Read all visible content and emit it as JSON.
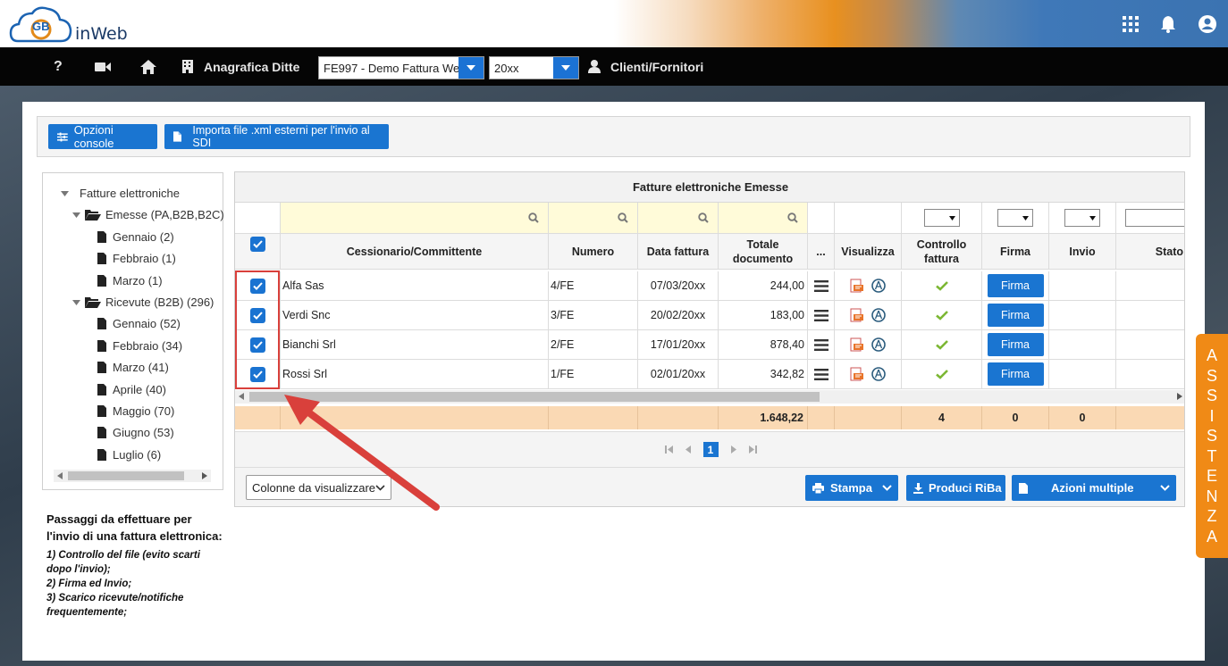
{
  "header": {
    "logo_text": "inWeb",
    "logo_badge": "GB",
    "icons": [
      "apps-grid-icon",
      "bell-icon",
      "user-circle-icon"
    ]
  },
  "navbar": {
    "help": "?",
    "company_label": "Anagrafica Ditte",
    "company_select": "FE997 - Demo Fattura We",
    "year_select": "20xx",
    "clients_label": "Clienti/Fornitori"
  },
  "toolbar": {
    "options_label": "Opzioni console",
    "import_label": "Importa file .xml esterni per l'invio al SDI"
  },
  "tree": {
    "root": "Fatture elettroniche",
    "emesse": "Emesse (PA,B2B,B2C)",
    "emesse_months": [
      "Gennaio (2)",
      "Febbraio (1)",
      "Marzo (1)"
    ],
    "ricevute": "Ricevute (B2B) (296)",
    "ricevute_months": [
      "Gennaio (52)",
      "Febbraio (34)",
      "Marzo (41)",
      "Aprile (40)",
      "Maggio (70)",
      "Giugno (53)",
      "Luglio (6)"
    ]
  },
  "instructions": {
    "title": "Passaggi da effettuare per l'invio di una fattura elettronica:",
    "step1": "1) Controllo del file (evito scarti dopo l'invio);",
    "step2": "2) Firma ed Invio;",
    "step3": "3) Scarico ricevute/notifiche frequentemente;"
  },
  "grid": {
    "title": "Fatture elettroniche Emesse",
    "columns": {
      "cessionario": "Cessionario/Committente",
      "numero": "Numero",
      "data": "Data fattura",
      "totale": "Totale documento",
      "more": "...",
      "visualizza": "Visualizza",
      "controllo": "Controllo fattura",
      "firma": "Firma",
      "invio": "Invio",
      "stato": "Stato"
    },
    "rows": [
      {
        "cessionario": "Alfa Sas",
        "numero": "4/FE",
        "data": "07/03/20xx",
        "totale": "244,00",
        "firma": "Firma"
      },
      {
        "cessionario": "Verdi Snc",
        "numero": "3/FE",
        "data": "20/02/20xx",
        "totale": "183,00",
        "firma": "Firma"
      },
      {
        "cessionario": "Bianchi Srl",
        "numero": "2/FE",
        "data": "17/01/20xx",
        "totale": "878,40",
        "firma": "Firma"
      },
      {
        "cessionario": "Rossi Srl",
        "numero": "1/FE",
        "data": "02/01/20xx",
        "totale": "342,82",
        "firma": "Firma"
      }
    ],
    "totals": {
      "totale": "1.648,22",
      "controllo": "4",
      "firma": "0",
      "invio": "0"
    },
    "page": "1"
  },
  "bottom": {
    "columns_select": "Colonne da visualizzare",
    "stampa": "Stampa",
    "riba": "Produci RiBa",
    "azioni": "Azioni multiple"
  },
  "assistenza": [
    "A",
    "S",
    "S",
    "I",
    "S",
    "T",
    "E",
    "N",
    "Z",
    "A"
  ],
  "colors": {
    "accent": "#1a75d1",
    "orange": "#f08a16",
    "highlight": "#d9403b"
  }
}
